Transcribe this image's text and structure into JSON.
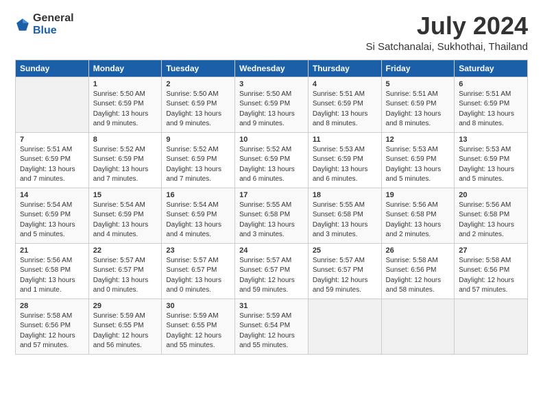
{
  "header": {
    "logo_general": "General",
    "logo_blue": "Blue",
    "title": "July 2024",
    "subtitle": "Si Satchanalai, Sukhothai, Thailand"
  },
  "weekdays": [
    "Sunday",
    "Monday",
    "Tuesday",
    "Wednesday",
    "Thursday",
    "Friday",
    "Saturday"
  ],
  "weeks": [
    [
      {
        "day": "",
        "info": ""
      },
      {
        "day": "1",
        "info": "Sunrise: 5:50 AM\nSunset: 6:59 PM\nDaylight: 13 hours\nand 9 minutes."
      },
      {
        "day": "2",
        "info": "Sunrise: 5:50 AM\nSunset: 6:59 PM\nDaylight: 13 hours\nand 9 minutes."
      },
      {
        "day": "3",
        "info": "Sunrise: 5:50 AM\nSunset: 6:59 PM\nDaylight: 13 hours\nand 9 minutes."
      },
      {
        "day": "4",
        "info": "Sunrise: 5:51 AM\nSunset: 6:59 PM\nDaylight: 13 hours\nand 8 minutes."
      },
      {
        "day": "5",
        "info": "Sunrise: 5:51 AM\nSunset: 6:59 PM\nDaylight: 13 hours\nand 8 minutes."
      },
      {
        "day": "6",
        "info": "Sunrise: 5:51 AM\nSunset: 6:59 PM\nDaylight: 13 hours\nand 8 minutes."
      }
    ],
    [
      {
        "day": "7",
        "info": "Sunrise: 5:51 AM\nSunset: 6:59 PM\nDaylight: 13 hours\nand 7 minutes."
      },
      {
        "day": "8",
        "info": "Sunrise: 5:52 AM\nSunset: 6:59 PM\nDaylight: 13 hours\nand 7 minutes."
      },
      {
        "day": "9",
        "info": "Sunrise: 5:52 AM\nSunset: 6:59 PM\nDaylight: 13 hours\nand 7 minutes."
      },
      {
        "day": "10",
        "info": "Sunrise: 5:52 AM\nSunset: 6:59 PM\nDaylight: 13 hours\nand 6 minutes."
      },
      {
        "day": "11",
        "info": "Sunrise: 5:53 AM\nSunset: 6:59 PM\nDaylight: 13 hours\nand 6 minutes."
      },
      {
        "day": "12",
        "info": "Sunrise: 5:53 AM\nSunset: 6:59 PM\nDaylight: 13 hours\nand 5 minutes."
      },
      {
        "day": "13",
        "info": "Sunrise: 5:53 AM\nSunset: 6:59 PM\nDaylight: 13 hours\nand 5 minutes."
      }
    ],
    [
      {
        "day": "14",
        "info": "Sunrise: 5:54 AM\nSunset: 6:59 PM\nDaylight: 13 hours\nand 5 minutes."
      },
      {
        "day": "15",
        "info": "Sunrise: 5:54 AM\nSunset: 6:59 PM\nDaylight: 13 hours\nand 4 minutes."
      },
      {
        "day": "16",
        "info": "Sunrise: 5:54 AM\nSunset: 6:59 PM\nDaylight: 13 hours\nand 4 minutes."
      },
      {
        "day": "17",
        "info": "Sunrise: 5:55 AM\nSunset: 6:58 PM\nDaylight: 13 hours\nand 3 minutes."
      },
      {
        "day": "18",
        "info": "Sunrise: 5:55 AM\nSunset: 6:58 PM\nDaylight: 13 hours\nand 3 minutes."
      },
      {
        "day": "19",
        "info": "Sunrise: 5:56 AM\nSunset: 6:58 PM\nDaylight: 13 hours\nand 2 minutes."
      },
      {
        "day": "20",
        "info": "Sunrise: 5:56 AM\nSunset: 6:58 PM\nDaylight: 13 hours\nand 2 minutes."
      }
    ],
    [
      {
        "day": "21",
        "info": "Sunrise: 5:56 AM\nSunset: 6:58 PM\nDaylight: 13 hours\nand 1 minute."
      },
      {
        "day": "22",
        "info": "Sunrise: 5:57 AM\nSunset: 6:57 PM\nDaylight: 13 hours\nand 0 minutes."
      },
      {
        "day": "23",
        "info": "Sunrise: 5:57 AM\nSunset: 6:57 PM\nDaylight: 13 hours\nand 0 minutes."
      },
      {
        "day": "24",
        "info": "Sunrise: 5:57 AM\nSunset: 6:57 PM\nDaylight: 12 hours\nand 59 minutes."
      },
      {
        "day": "25",
        "info": "Sunrise: 5:57 AM\nSunset: 6:57 PM\nDaylight: 12 hours\nand 59 minutes."
      },
      {
        "day": "26",
        "info": "Sunrise: 5:58 AM\nSunset: 6:56 PM\nDaylight: 12 hours\nand 58 minutes."
      },
      {
        "day": "27",
        "info": "Sunrise: 5:58 AM\nSunset: 6:56 PM\nDaylight: 12 hours\nand 57 minutes."
      }
    ],
    [
      {
        "day": "28",
        "info": "Sunrise: 5:58 AM\nSunset: 6:56 PM\nDaylight: 12 hours\nand 57 minutes."
      },
      {
        "day": "29",
        "info": "Sunrise: 5:59 AM\nSunset: 6:55 PM\nDaylight: 12 hours\nand 56 minutes."
      },
      {
        "day": "30",
        "info": "Sunrise: 5:59 AM\nSunset: 6:55 PM\nDaylight: 12 hours\nand 55 minutes."
      },
      {
        "day": "31",
        "info": "Sunrise: 5:59 AM\nSunset: 6:54 PM\nDaylight: 12 hours\nand 55 minutes."
      },
      {
        "day": "",
        "info": ""
      },
      {
        "day": "",
        "info": ""
      },
      {
        "day": "",
        "info": ""
      }
    ]
  ]
}
